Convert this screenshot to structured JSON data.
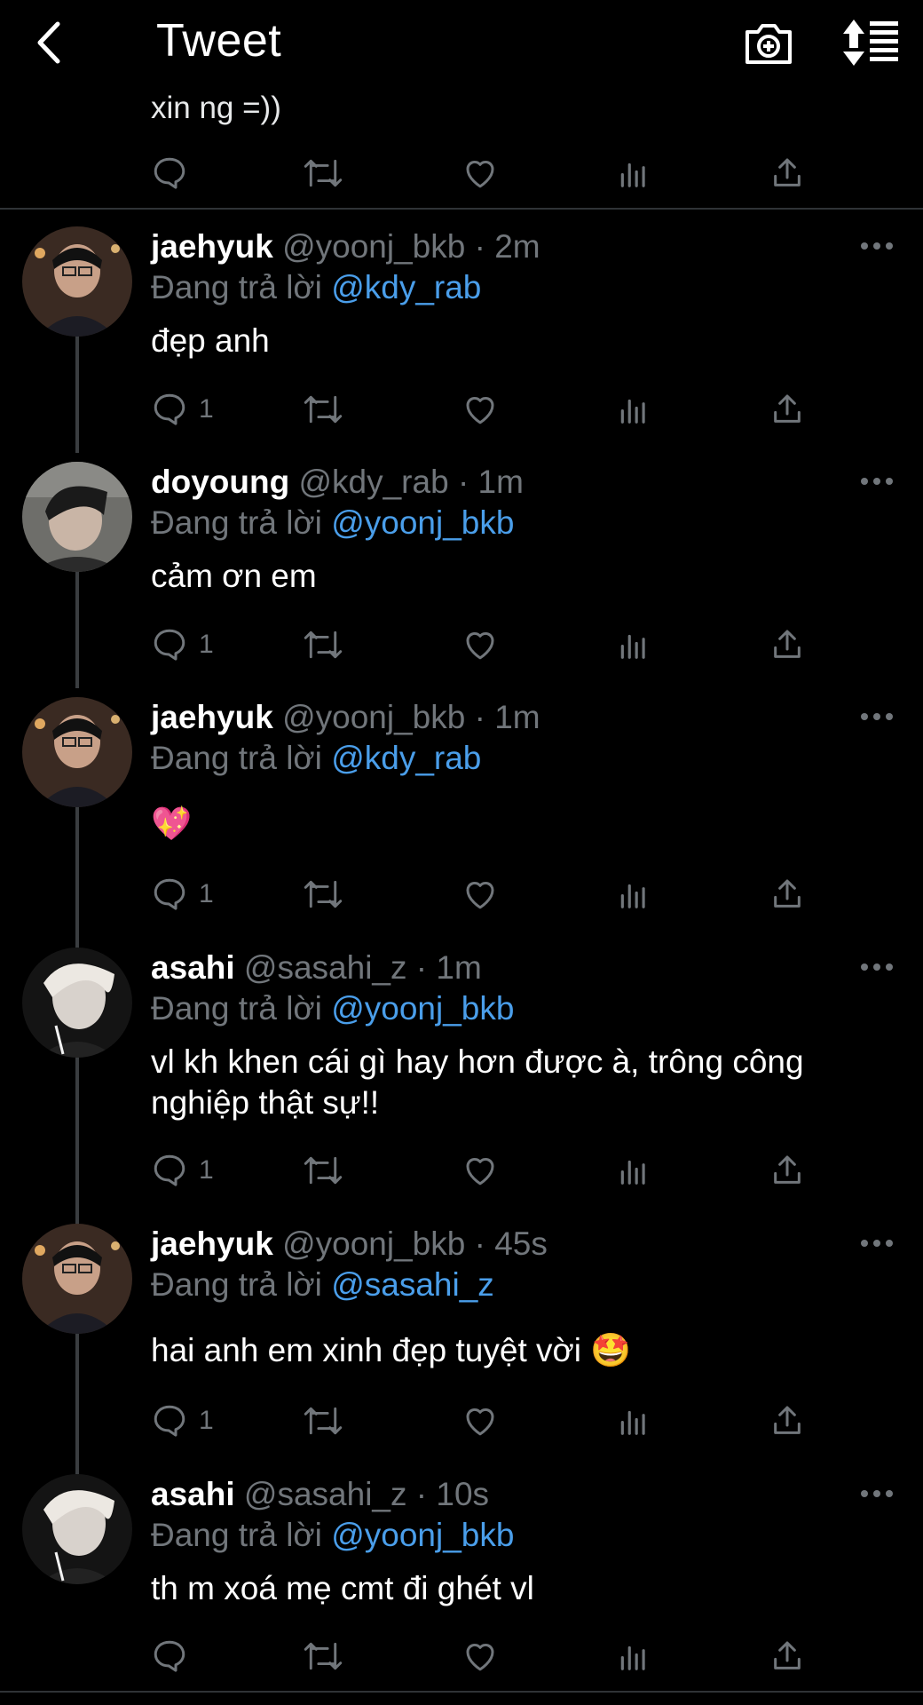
{
  "header": {
    "title": "Tweet",
    "back_icon": "chevron-left-icon",
    "camera_icon": "camera-plus-icon",
    "sort_icon": "sort-list-icon"
  },
  "previous_tweet": {
    "text": "xin ng =))"
  },
  "reply_prefix": "Đang trả lời",
  "colors": {
    "background": "#000000",
    "text": "#e7e9ea",
    "muted": "#71767b",
    "mention": "#4a9eea",
    "divider": "#2f3336"
  },
  "tweets": [
    {
      "name": "jaehyuk",
      "handle": "@yoonj_bkb · 2m",
      "reply_to": "@kdy_rab",
      "text": "đẹp anh",
      "reply_count": "1"
    },
    {
      "name": "doyoung",
      "handle": "@kdy_rab · 1m",
      "reply_to": "@yoonj_bkb",
      "text": "cảm ơn em",
      "reply_count": "1"
    },
    {
      "name": "jaehyuk",
      "handle": "@yoonj_bkb · 1m",
      "reply_to": "@kdy_rab",
      "text": "💖",
      "reply_count": "1"
    },
    {
      "name": "asahi",
      "handle": "@sasahi_z · 1m",
      "reply_to": "@yoonj_bkb",
      "text": "vl kh khen cái gì hay hơn được à, trông công nghiệp thật sự!!",
      "reply_count": "1"
    },
    {
      "name": "jaehyuk",
      "handle": "@yoonj_bkb · 45s",
      "reply_to": "@sasahi_z",
      "text": "hai anh em xinh đẹp tuyệt vời 🤩",
      "reply_count": "1"
    },
    {
      "name": "asahi",
      "handle": "@sasahi_z · 10s",
      "reply_to": "@yoonj_bkb",
      "text": "th m xoá mẹ cmt đi ghét vl",
      "reply_count": ""
    }
  ]
}
